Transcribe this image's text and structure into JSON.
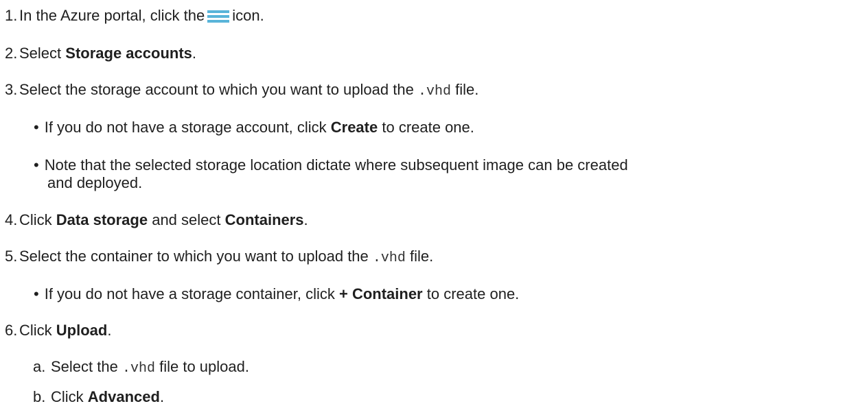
{
  "steps": {
    "s1": {
      "num": "1.",
      "before": "In the Azure portal, click the",
      "after": "icon."
    },
    "s2": {
      "num": "2.",
      "before": "Select",
      "bold": "Storage accounts",
      "after": "."
    },
    "s3": {
      "num": "3.",
      "before": "Select the storage account to which you want to upload the",
      "code": ".vhd",
      "after": "file.",
      "bullets": [
        {
          "before": "If you do not have a storage account, click",
          "bold": "Create",
          "after": "to create one."
        },
        {
          "line1": "Note that the selected storage location dictate where subsequent image can be created",
          "line2": "and deployed."
        }
      ]
    },
    "s4": {
      "num": "4.",
      "before": "Click",
      "bold1": "Data storage",
      "middle": "and select",
      "bold2": "Containers",
      "after": "."
    },
    "s5": {
      "num": "5.",
      "before": "Select the container to which you want to upload the",
      "code": ".vhd",
      "after": "file.",
      "bullets": [
        {
          "before": "If you do not have a storage container, click",
          "bold": "+ Container",
          "after": "to create one."
        }
      ]
    },
    "s6": {
      "num": "6.",
      "before": "Click",
      "bold": "Upload",
      "after": ".",
      "sub": [
        {
          "letter": "a.",
          "before": "Select the",
          "code": ".vhd",
          "after": "file to upload."
        },
        {
          "letter": "b.",
          "before": "Click",
          "bold": "Advanced",
          "after": "."
        }
      ]
    }
  },
  "icons": {
    "menu": "hamburger-menu-icon",
    "menu_color": "#59b4d9"
  },
  "bullet_char": "•"
}
